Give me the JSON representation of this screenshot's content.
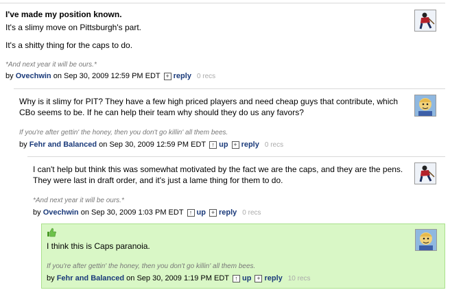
{
  "comments": [
    {
      "title": "I've made my position known.",
      "lines": [
        "It's a slimy move on Pittsburgh's part.",
        "It's a shitty thing for the caps to do."
      ],
      "signature": "*And next year it will be ours.*",
      "by_label": "by",
      "author": "Ovechwin",
      "date": "on Sep 30, 2009 12:59 PM EDT",
      "reply_label": "reply",
      "recs": "0 recs",
      "avatar_icon": "hockey-player-avatar"
    },
    {
      "lines": [
        "Why is it slimy for PIT? They have a few high priced players and need cheap guys that contribute, which",
        "CBo seems to be. If he can help their team why should they do us any favors?"
      ],
      "signature": "If you're after gettin' the honey, then you don't go killin' all them bees.",
      "by_label": "by",
      "author": "Fehr and Balanced",
      "date": "on Sep 30, 2009 12:59 PM EDT",
      "up_label": "up",
      "reply_label": "reply",
      "recs": "0 recs",
      "avatar_icon": "cartoon-avatar"
    },
    {
      "lines": [
        "I can't help but think this was somewhat motivated by the fact we are the caps, and they are the pens.",
        "They were last in draft order, and it's just a lame thing for them to do."
      ],
      "signature": "*And next year it will be ours.*",
      "by_label": "by",
      "author": "Ovechwin",
      "date": "on Sep 30, 2009 1:03 PM EDT",
      "up_label": "up",
      "reply_label": "reply",
      "recs": "0 recs",
      "avatar_icon": "hockey-player-avatar"
    },
    {
      "lines": [
        "I think this is Caps paranoia."
      ],
      "signature": "If you're after gettin' the honey, then you don't go killin' all them bees.",
      "by_label": "by",
      "author": "Fehr and Balanced",
      "date": "on Sep 30, 2009 1:19 PM EDT",
      "up_label": "up",
      "reply_label": "reply",
      "recs": "10 recs",
      "avatar_icon": "cartoon-avatar",
      "highlight_color": "#d9f7c6"
    }
  ],
  "icons": {
    "up": "↑",
    "reply": "+"
  }
}
